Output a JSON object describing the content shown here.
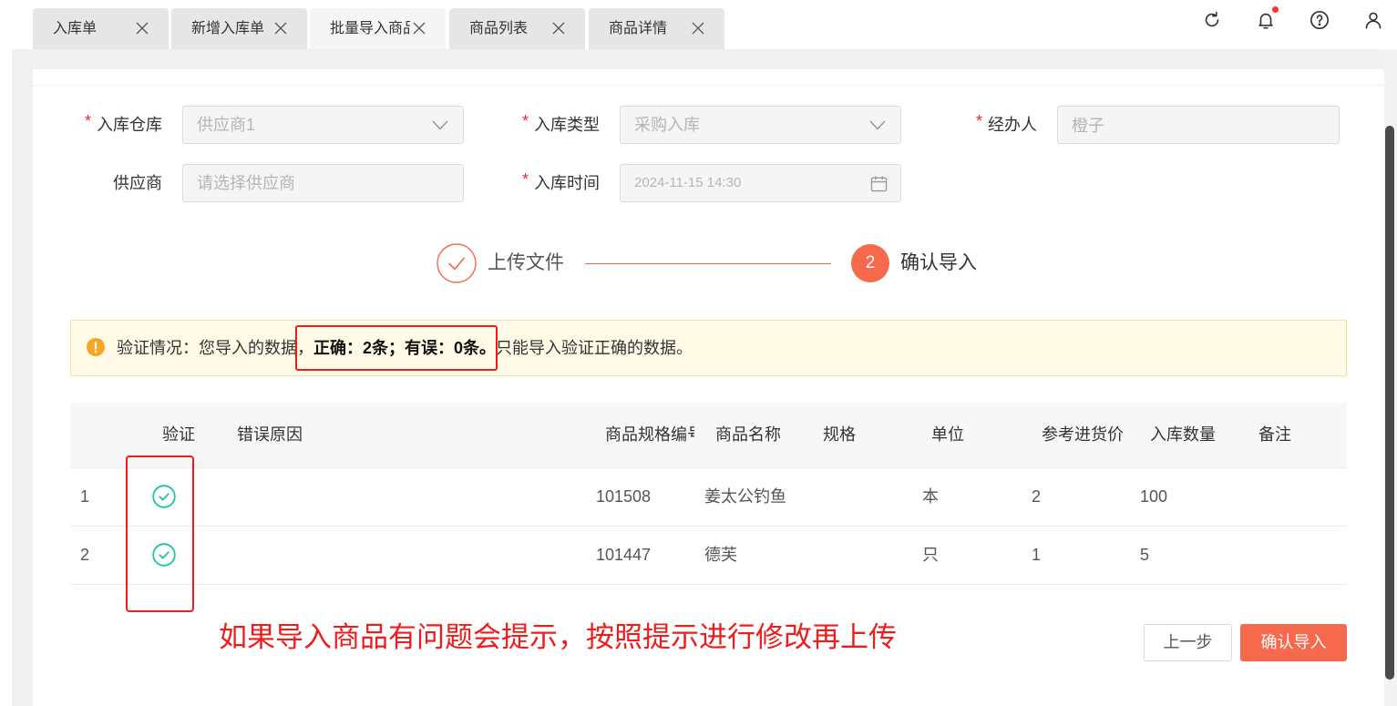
{
  "tabs": [
    {
      "label": "入库单",
      "active": false
    },
    {
      "label": "新增入库单",
      "active": false
    },
    {
      "label": "批量导入商品",
      "active": true
    },
    {
      "label": "商品列表",
      "active": false
    },
    {
      "label": "商品详情",
      "active": false
    }
  ],
  "toolbar": {
    "icons": [
      "refresh-icon",
      "bell-icon",
      "help-icon",
      "user-icon"
    ],
    "has_unread_notifications": true
  },
  "form": {
    "required_mark": "*",
    "warehouse": {
      "label": "入库仓库",
      "value": "供应商1"
    },
    "inbound_type": {
      "label": "入库类型",
      "value": "采购入库"
    },
    "handler": {
      "label": "经办人",
      "value": "橙子"
    },
    "supplier": {
      "label": "供应商",
      "placeholder": "请选择供应商"
    },
    "inbound_time": {
      "label": "入库时间",
      "value": "2024-11-15 14:30"
    }
  },
  "steps": [
    {
      "label": "上传文件",
      "completed": true
    },
    {
      "number": "2",
      "label": "确认导入",
      "current": true
    }
  ],
  "alert": {
    "icon": "warning-icon",
    "prefix": "验证情况：您导入的数据，",
    "highlight": "正确：2条；有误：0条。",
    "suffix": "只能导入验证正确的数据。"
  },
  "table": {
    "columns": [
      "验证",
      "错误原因",
      "商品规格编号",
      "商品名称",
      "规格",
      "单位",
      "参考进货价",
      "入库数量",
      "备注"
    ],
    "rows": [
      {
        "index": "1",
        "valid": true,
        "error": "",
        "code": "101508",
        "name": "姜太公钓鱼",
        "spec": "",
        "unit": "本",
        "price": "2",
        "qty": "100",
        "remark": ""
      },
      {
        "index": "2",
        "valid": true,
        "error": "",
        "code": "101447",
        "name": "德芙",
        "spec": "",
        "unit": "只",
        "price": "1",
        "qty": "5",
        "remark": ""
      }
    ]
  },
  "annotation": {
    "text": "如果导入商品有问题会提示，按照提示进行修改再上传"
  },
  "buttons": {
    "prev": "上一步",
    "confirm": "确认导入"
  },
  "colors": {
    "accent": "#f7694d",
    "success": "#1bc5a1",
    "warning": "#f5a623",
    "annotation": "#f01c1c"
  }
}
